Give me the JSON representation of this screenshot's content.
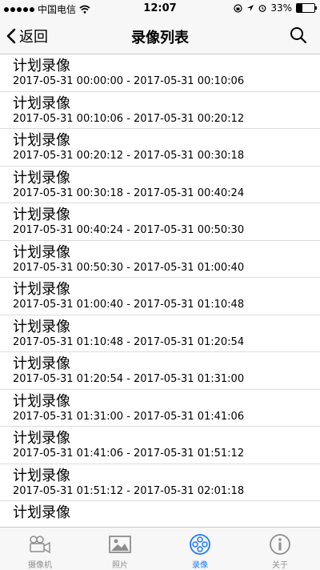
{
  "status": {
    "carrier": "中国电信",
    "time": "12:07",
    "battery": "33%",
    "battery_level": 0.33
  },
  "nav": {
    "back_label": "返回",
    "title": "录像列表"
  },
  "recordings": [
    {
      "title": "计划录像",
      "range": "2017-05-31 00:00:00 - 2017-05-31 00:10:06"
    },
    {
      "title": "计划录像",
      "range": "2017-05-31 00:10:06 - 2017-05-31 00:20:12"
    },
    {
      "title": "计划录像",
      "range": "2017-05-31 00:20:12 - 2017-05-31 00:30:18"
    },
    {
      "title": "计划录像",
      "range": "2017-05-31 00:30:18 - 2017-05-31 00:40:24"
    },
    {
      "title": "计划录像",
      "range": "2017-05-31 00:40:24 - 2017-05-31 00:50:30"
    },
    {
      "title": "计划录像",
      "range": "2017-05-31 00:50:30 - 2017-05-31 01:00:40"
    },
    {
      "title": "计划录像",
      "range": "2017-05-31 01:00:40 - 2017-05-31 01:10:48"
    },
    {
      "title": "计划录像",
      "range": "2017-05-31 01:10:48 - 2017-05-31 01:20:54"
    },
    {
      "title": "计划录像",
      "range": "2017-05-31 01:20:54 - 2017-05-31 01:31:00"
    },
    {
      "title": "计划录像",
      "range": "2017-05-31 01:31:00 - 2017-05-31 01:41:06"
    },
    {
      "title": "计划录像",
      "range": "2017-05-31 01:41:06 - 2017-05-31 01:51:12"
    },
    {
      "title": "计划录像",
      "range": "2017-05-31 01:51:12 - 2017-05-31 02:01:18"
    },
    {
      "title": "计划录像",
      "range": ""
    }
  ],
  "tabs": [
    {
      "label": "摄像机",
      "icon": "camera-icon",
      "active": false
    },
    {
      "label": "照片",
      "icon": "photo-icon",
      "active": false
    },
    {
      "label": "录像",
      "icon": "film-reel-icon",
      "active": true
    },
    {
      "label": "关于",
      "icon": "info-icon",
      "active": false
    }
  ],
  "colors": {
    "accent": "#1b7bff",
    "inactive": "#8e8e8e",
    "bar_bg": "#f7f7f7"
  }
}
